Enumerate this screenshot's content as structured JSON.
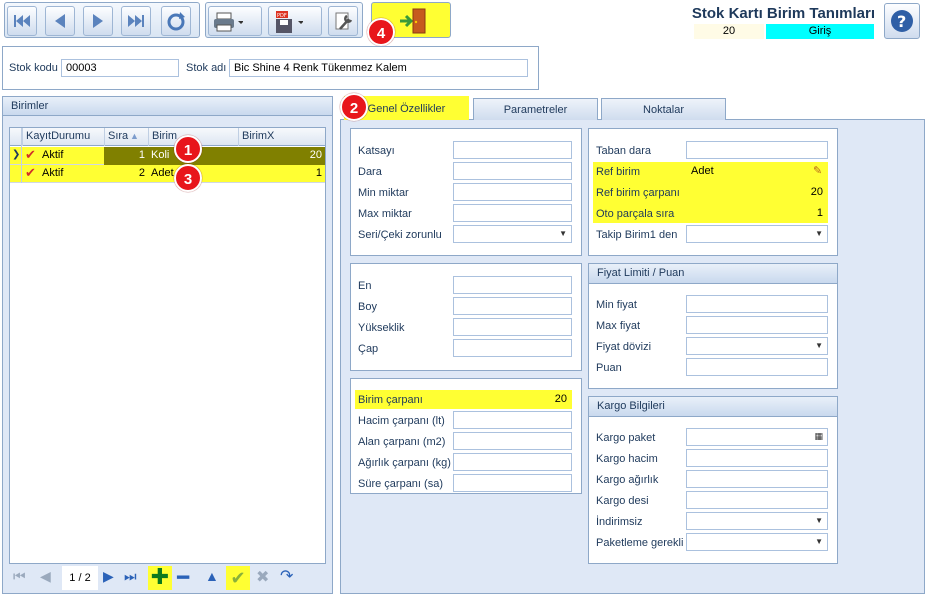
{
  "window_title": "Stok Kartı Birim Tanımları",
  "header": {
    "record_no": "20",
    "mode": "Giriş"
  },
  "colors": {
    "highlight": "#ffff33",
    "mode_bg": "#00ffff",
    "badge": "#e8151b",
    "row_selected": "#808000"
  },
  "badges": {
    "b1": "1",
    "b2": "2",
    "b3": "3",
    "b4": "4"
  },
  "stock": {
    "code_label": "Stok kodu",
    "code_value": "00003",
    "name_label": "Stok adı",
    "name_value": "Bic Shine 4 Renk Tükenmez Kalem"
  },
  "birimler": {
    "title": "Birimler",
    "columns": [
      "KayıtDurumu",
      "Sıra",
      "Birim",
      "BirimX"
    ],
    "rows": [
      {
        "durum": "Aktif",
        "sira": "1",
        "birim": "Koli",
        "birimx": "20"
      },
      {
        "durum": "Aktif",
        "sira": "2",
        "birim": "Adet",
        "birimx": "1"
      }
    ],
    "pager": "1 / 2"
  },
  "tabs": [
    "Genel Özellikler",
    "Parametreler",
    "Noktalar"
  ],
  "genel": {
    "katsayi": "Katsayı",
    "dara": "Dara",
    "min_miktar": "Min miktar",
    "max_miktar": "Max miktar",
    "seri_ceki": "Seri/Çeki zorunlu",
    "en": "En",
    "boy": "Boy",
    "yukseklik": "Yükseklik",
    "cap": "Çap",
    "birim_carpani": "Birim çarpanı",
    "birim_carpani_value": "20",
    "hacim": "Hacim çarpanı (lt)",
    "alan": "Alan çarpanı (m2)",
    "agirlik": "Ağırlık çarpanı (kg)",
    "sure": "Süre çarpanı (sa)",
    "taban_dara": "Taban dara",
    "ref_birim": "Ref birim",
    "ref_birim_value": "Adet",
    "ref_birim_carpani": "Ref birim çarpanı",
    "ref_birim_carpani_value": "20",
    "oto_parcala": "Oto parçala sıra",
    "oto_parcala_value": "1",
    "takip_birim": "Takip Birim1 den"
  },
  "fiyat": {
    "title": "Fiyat Limiti / Puan",
    "min": "Min fiyat",
    "max": "Max fiyat",
    "doviz": "Fiyat dövizi",
    "puan": "Puan"
  },
  "kargo": {
    "title": "Kargo Bilgileri",
    "paket": "Kargo paket",
    "hacim": "Kargo hacim",
    "agirlik": "Kargo ağırlık",
    "desi": "Kargo desi",
    "indirimsiz": "İndirimsiz",
    "paketleme": "Paketleme gerekli"
  }
}
